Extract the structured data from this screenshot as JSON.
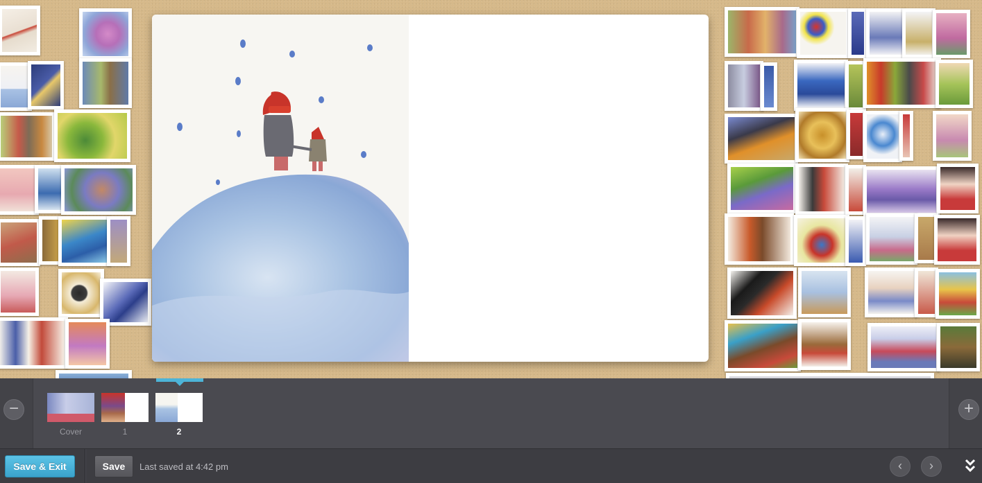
{
  "filmstrip": {
    "pages": [
      {
        "label": "Cover"
      },
      {
        "label": "1"
      },
      {
        "label": "2"
      }
    ],
    "active_page": "2",
    "zoom_out_icon": "minus-icon",
    "zoom_in_icon": "plus-icon"
  },
  "toolbar": {
    "save_exit_label": "Save & Exit",
    "save_label": "Save",
    "status_text": "Last saved at 4:42 pm",
    "prev_icon": "chevron-left-icon",
    "next_icon": "chevron-right-icon",
    "collapse_icon": "double-chevron-down-icon"
  },
  "colors": {
    "accent": "#4db4d8",
    "cork": "#d6b98a",
    "bar": "#4a4a50",
    "toolbar": "#3d3d42"
  }
}
